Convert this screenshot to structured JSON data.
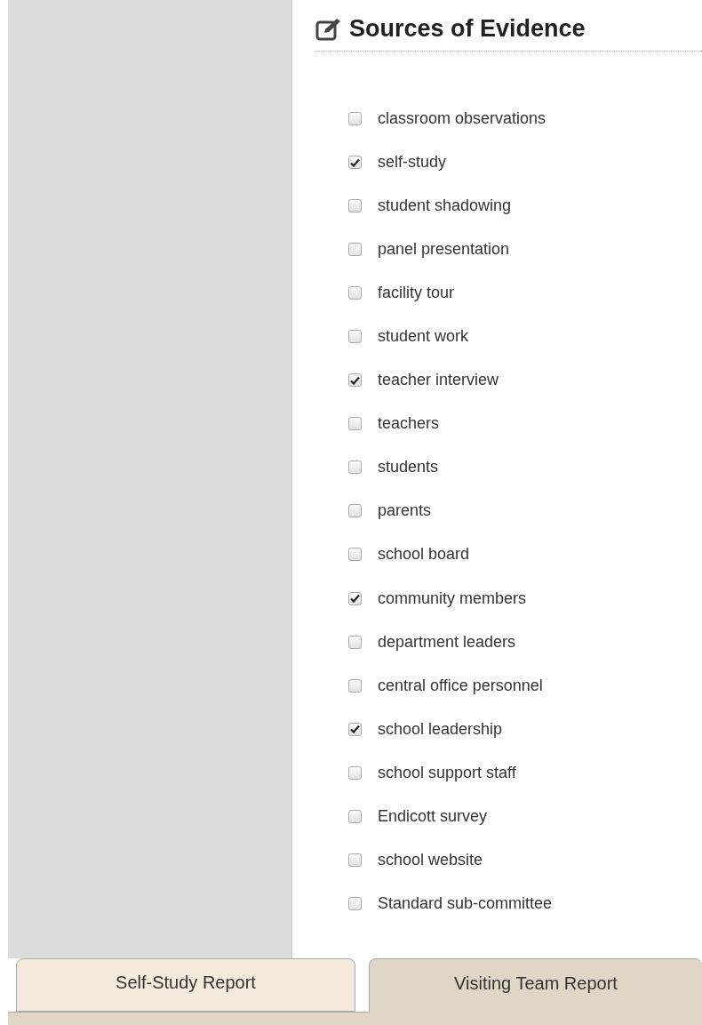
{
  "section": {
    "title": "Sources of Evidence"
  },
  "sources": [
    {
      "label": "classroom observations",
      "checked": false
    },
    {
      "label": "self-study",
      "checked": true
    },
    {
      "label": "student shadowing",
      "checked": false
    },
    {
      "label": "panel presentation",
      "checked": false
    },
    {
      "label": "facility tour",
      "checked": false
    },
    {
      "label": "student work",
      "checked": false
    },
    {
      "label": "teacher interview",
      "checked": true
    },
    {
      "label": "teachers",
      "checked": false
    },
    {
      "label": "students",
      "checked": false
    },
    {
      "label": "parents",
      "checked": false
    },
    {
      "label": "school board",
      "checked": false
    },
    {
      "label": "community members",
      "checked": true
    },
    {
      "label": "department leaders",
      "checked": false
    },
    {
      "label": "central office personnel",
      "checked": false
    },
    {
      "label": "school leadership",
      "checked": true
    },
    {
      "label": "school support staff",
      "checked": false
    },
    {
      "label": "Endicott survey",
      "checked": false
    },
    {
      "label": "school website",
      "checked": false
    },
    {
      "label": "Standard sub-committee",
      "checked": false
    }
  ],
  "tabs": [
    {
      "label": "Self-Study Report",
      "selected": false
    },
    {
      "label": "Visiting Team Report",
      "selected": true
    }
  ]
}
